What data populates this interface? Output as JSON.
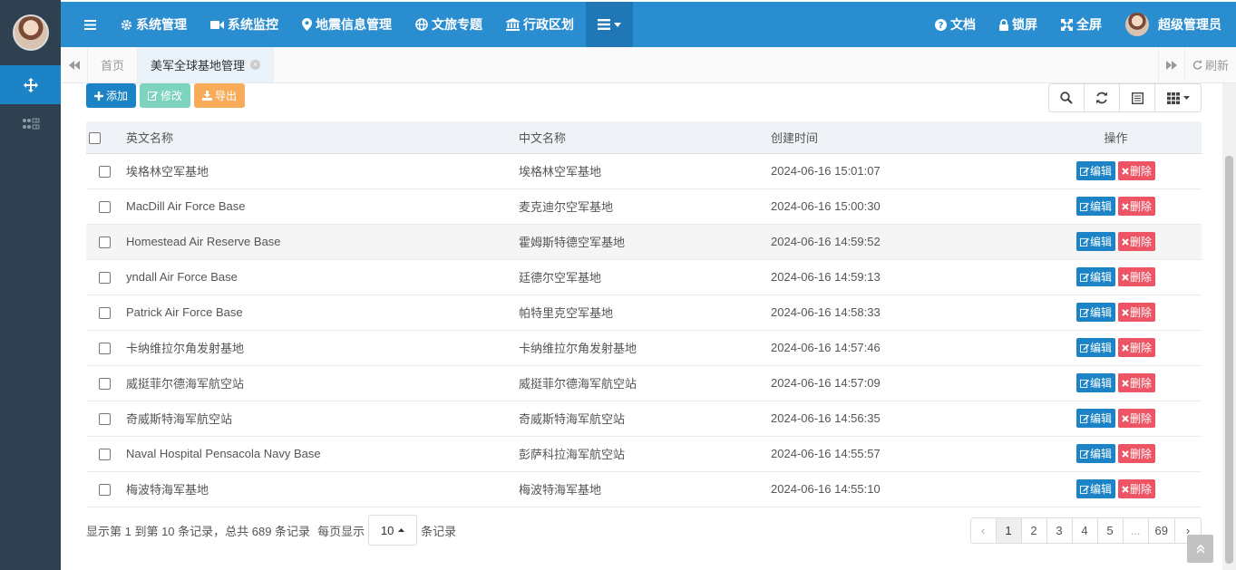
{
  "topnav": {
    "items": [
      {
        "icon": "gear-icon",
        "label": "系统管理"
      },
      {
        "icon": "video-camera-icon",
        "label": "系统监控"
      },
      {
        "icon": "map-pin-icon",
        "label": "地震信息管理"
      },
      {
        "icon": "globe-icon",
        "label": "文旅专题"
      },
      {
        "icon": "bank-icon",
        "label": "行政区划"
      }
    ],
    "right": {
      "docs": "文档",
      "lock": "锁屏",
      "fullscreen": "全屏",
      "user": "超级管理员"
    }
  },
  "tabs": {
    "home": "首页",
    "active": "美军全球基地管理",
    "refresh": "刷新"
  },
  "toolbar": {
    "add": "添加",
    "edit": "修改",
    "export": "导出"
  },
  "table": {
    "headers": {
      "en": "英文名称",
      "cn": "中文名称",
      "time": "创建时间",
      "op": "操作"
    },
    "edit_label": "编辑",
    "delete_label": "删除",
    "rows": [
      {
        "en": "埃格林空军基地",
        "cn": "埃格林空军基地",
        "time": "2024-06-16 15:01:07"
      },
      {
        "en": "MacDill Air Force Base",
        "cn": "麦克迪尔空军基地",
        "time": "2024-06-16 15:00:30"
      },
      {
        "en": "Homestead Air Reserve Base",
        "cn": "霍姆斯特德空军基地",
        "time": "2024-06-16 14:59:52"
      },
      {
        "en": "yndall Air Force Base",
        "cn": "廷德尔空军基地",
        "time": "2024-06-16 14:59:13"
      },
      {
        "en": "Patrick Air Force Base",
        "cn": "帕特里克空军基地",
        "time": "2024-06-16 14:58:33"
      },
      {
        "en": "卡纳维拉尔角发射基地",
        "cn": "卡纳维拉尔角发射基地",
        "time": "2024-06-16 14:57:46"
      },
      {
        "en": "威挺菲尔德海军航空站",
        "cn": "威挺菲尔德海军航空站",
        "time": "2024-06-16 14:57:09"
      },
      {
        "en": "奇威斯特海军航空站",
        "cn": "奇威斯特海军航空站",
        "time": "2024-06-16 14:56:35"
      },
      {
        "en": "Naval Hospital Pensacola Navy Base",
        "cn": "彭萨科拉海军航空站",
        "time": "2024-06-16 14:55:57"
      },
      {
        "en": "梅波特海军基地",
        "cn": "梅波特海军基地",
        "time": "2024-06-16 14:55:10"
      }
    ]
  },
  "footer": {
    "summary": "显示第 1 到第 10 条记录，总共 689 条记录",
    "per_page_prefix": "每页显示",
    "page_size": "10",
    "per_page_suffix": "条记录"
  },
  "pagination": {
    "prev": "‹",
    "pages": [
      "1",
      "2",
      "3",
      "4",
      "5",
      "...",
      "69"
    ],
    "next": "›",
    "current": "1"
  }
}
